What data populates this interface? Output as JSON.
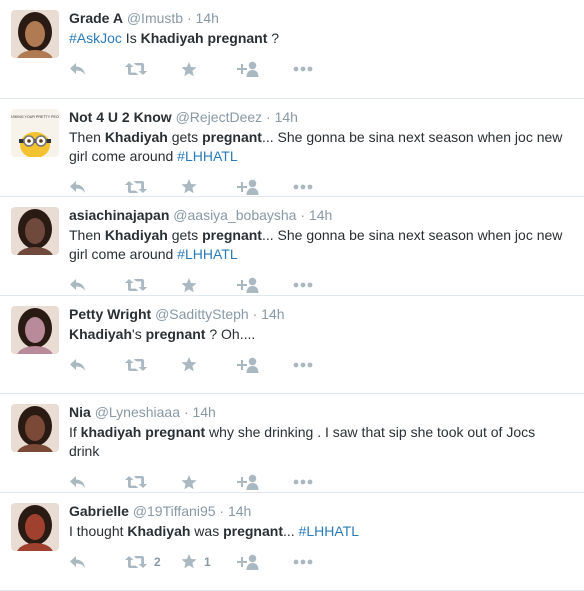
{
  "tweets": [
    {
      "fullname": "Grade A",
      "username": "@Imustb",
      "time": "14h",
      "segments": [
        {
          "t": "#AskJoc",
          "s": "hashtag"
        },
        {
          "t": " Is ",
          "s": ""
        },
        {
          "t": "Khadiyah",
          "s": "bold"
        },
        {
          "t": " ",
          "s": ""
        },
        {
          "t": "pregnant",
          "s": "bold"
        },
        {
          "t": " ?",
          "s": ""
        }
      ],
      "avatar_color": "#b07a52",
      "retweet_count": "",
      "favorite_count": ""
    },
    {
      "fullname": "Not 4 U 2 Know",
      "username": "@RejectDeez",
      "time": "14h",
      "segments": [
        {
          "t": "Then ",
          "s": ""
        },
        {
          "t": "Khadiyah",
          "s": "bold"
        },
        {
          "t": " gets ",
          "s": ""
        },
        {
          "t": "pregnant",
          "s": "bold"
        },
        {
          "t": "... She gonna be sina next season when joc new girl come around  ",
          "s": ""
        },
        {
          "t": "#LHHATL",
          "s": "hashtag"
        }
      ],
      "avatar_color": "#f2c230",
      "avatar_caption": "I'M ASKING YOUR PRETTY PEOPLE",
      "retweet_count": "",
      "favorite_count": ""
    },
    {
      "fullname": "asiachinajapan",
      "username": "@aasiya_bobaysha",
      "time": "14h",
      "segments": [
        {
          "t": "Then ",
          "s": ""
        },
        {
          "t": "Khadiyah",
          "s": "bold"
        },
        {
          "t": " gets ",
          "s": ""
        },
        {
          "t": "pregnant",
          "s": "bold"
        },
        {
          "t": "... She gonna be sina next season when joc new girl come around  ",
          "s": ""
        },
        {
          "t": "#LHHATL",
          "s": "hashtag"
        }
      ],
      "avatar_color": "#6f4a3c",
      "retweet_count": "",
      "favorite_count": ""
    },
    {
      "fullname": "Petty Wright",
      "username": "@SadittySteph",
      "time": "14h",
      "segments": [
        {
          "t": "Khadiyah",
          "s": "bold"
        },
        {
          "t": "'s ",
          "s": ""
        },
        {
          "t": "pregnant",
          "s": "bold"
        },
        {
          "t": " ? Oh....",
          "s": ""
        }
      ],
      "avatar_color": "#b98a9a",
      "retweet_count": "",
      "favorite_count": ""
    },
    {
      "fullname": "Nia",
      "username": "@Lyneshiaaa",
      "time": "14h",
      "segments": [
        {
          "t": "If ",
          "s": ""
        },
        {
          "t": "khadiyah",
          "s": "bold"
        },
        {
          "t": " ",
          "s": ""
        },
        {
          "t": "pregnant",
          "s": "bold"
        },
        {
          "t": " why she drinking . I saw that sip she took out of Jocs drink",
          "s": ""
        }
      ],
      "avatar_color": "#7a4a36",
      "retweet_count": "",
      "favorite_count": ""
    },
    {
      "fullname": "Gabrielle",
      "username": "@19Tiffani95",
      "time": "14h",
      "segments": [
        {
          "t": "I thought ",
          "s": ""
        },
        {
          "t": "Khadiyah",
          "s": "bold"
        },
        {
          "t": " was ",
          "s": ""
        },
        {
          "t": "pregnant",
          "s": "bold"
        },
        {
          "t": "... ",
          "s": ""
        },
        {
          "t": "#LHHATL",
          "s": "hashtag"
        }
      ],
      "avatar_color": "#a0412f",
      "retweet_count": "2",
      "favorite_count": "1"
    }
  ],
  "icons": {
    "reply": "reply-icon",
    "retweet": "retweet-icon",
    "favorite": "star-icon",
    "follow": "follow-icon",
    "more": "more-icon"
  },
  "colors": {
    "text": "#292f33",
    "muted": "#8899a6",
    "hashtag": "#2b7bb9",
    "icon": "#aab8c2",
    "divider": "#e1e8ed"
  }
}
